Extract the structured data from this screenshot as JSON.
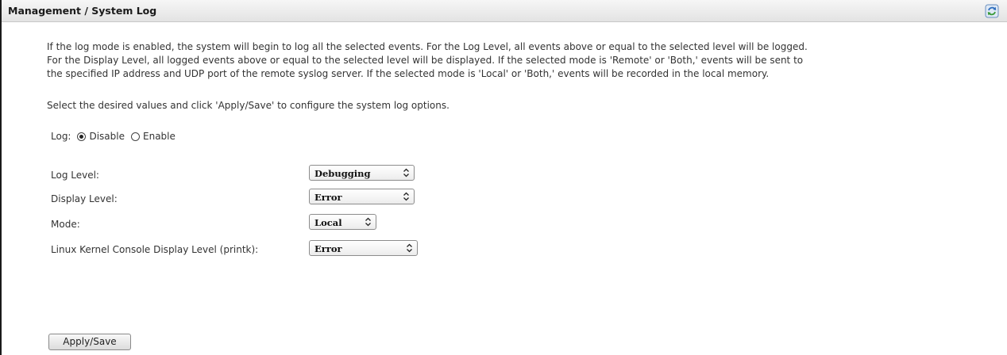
{
  "header": {
    "title": "Management / System Log",
    "refresh_icon": "refresh-icon"
  },
  "description": {
    "line1": "If the log mode is enabled, the system will begin to log all the selected events. For the Log Level, all events above or equal to the selected level will be logged.",
    "line2": "For the Display Level, all logged events above or equal to the selected level will be displayed. If the selected mode is 'Remote' or 'Both,' events will be sent to",
    "line3": "the specified IP address and UDP port of the remote syslog server. If the selected mode is 'Local' or 'Both,' events will be recorded in the local memory."
  },
  "instruction": "Select the desired values and click 'Apply/Save' to configure the system log options.",
  "log": {
    "label": "Log:",
    "options": [
      "Disable",
      "Enable"
    ],
    "selected": "Disable"
  },
  "fields": {
    "log_level": {
      "label": "Log Level:",
      "value": "Debugging"
    },
    "display_level": {
      "label": "Display Level:",
      "value": "Error"
    },
    "mode": {
      "label": "Mode:",
      "value": "Local"
    },
    "printk": {
      "label": "Linux Kernel Console Display Level (printk):",
      "value": "Error"
    }
  },
  "apply_button": "Apply/Save",
  "colors": {
    "header_bg": "#e8e8e8",
    "frame_border": "#1a1a1a",
    "text": "#333333"
  }
}
